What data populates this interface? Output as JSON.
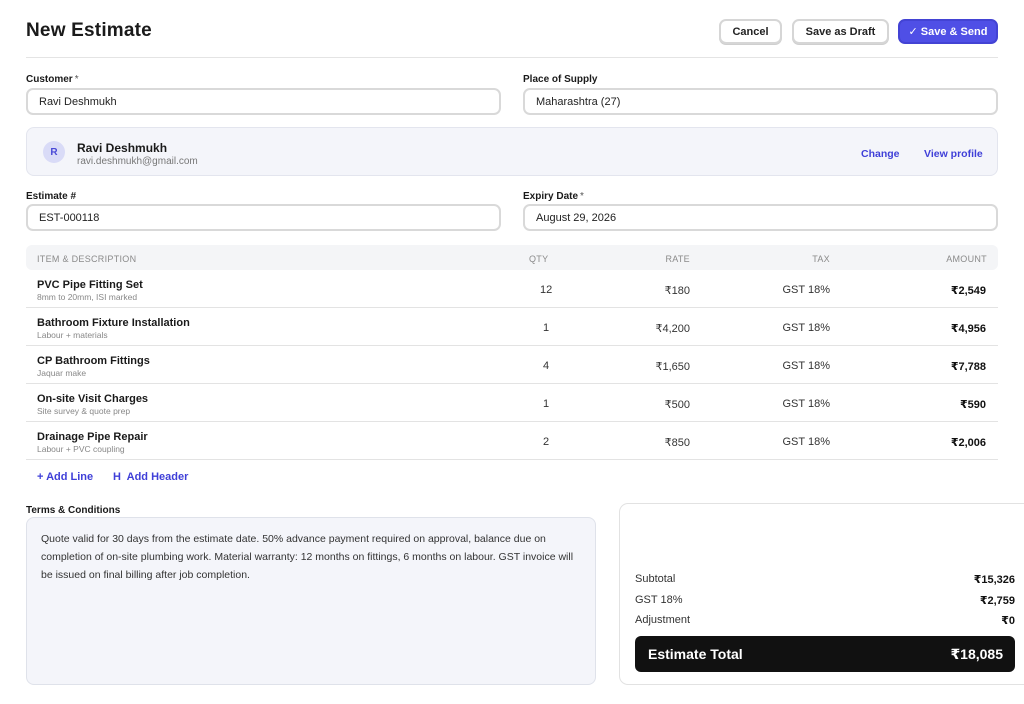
{
  "page": {
    "title": "New Estimate"
  },
  "actions": {
    "cancel": "Cancel",
    "save_draft": "Save as Draft",
    "save_send": "✓ Save & Send"
  },
  "form": {
    "customer_label": "Customer",
    "customer_value": "Ravi Deshmukh",
    "supply_label": "Place of Supply",
    "supply_value": "Maharashtra (27)",
    "estimate_label": "Estimate #",
    "estimate_value": "EST-000118",
    "expiry_label": "Expiry Date",
    "expiry_value": "August 29, 2026",
    "required_mark": "*"
  },
  "customer_card": {
    "initial": "R",
    "name": "Ravi Deshmukh",
    "email": "ravi.deshmukh@gmail.com",
    "change": "Change",
    "view_profile": "View profile"
  },
  "table": {
    "headers": {
      "item": "ITEM & DESCRIPTION",
      "qty": "QTY",
      "rate": "RATE",
      "tax": "TAX",
      "amount": "AMOUNT"
    },
    "rows": [
      {
        "name": "PVC Pipe Fitting Set",
        "desc": "8mm to 20mm, ISI marked",
        "qty": "12",
        "rate": "₹180",
        "tax": "GST 18%",
        "amount": "₹2,549"
      },
      {
        "name": "Bathroom Fixture Installation",
        "desc": "Labour + materials",
        "qty": "1",
        "rate": "₹4,200",
        "tax": "GST 18%",
        "amount": "₹4,956"
      },
      {
        "name": "CP Bathroom Fittings",
        "desc": "Jaquar make",
        "qty": "4",
        "rate": "₹1,650",
        "tax": "GST 18%",
        "amount": "₹7,788"
      },
      {
        "name": "On-site Visit Charges",
        "desc": "Site survey & quote prep",
        "qty": "1",
        "rate": "₹500",
        "tax": "GST 18%",
        "amount": "₹590"
      },
      {
        "name": "Drainage Pipe Repair",
        "desc": "Labour + PVC coupling",
        "qty": "2",
        "rate": "₹850",
        "tax": "GST 18%",
        "amount": "₹2,006"
      }
    ],
    "add_line": "+ Add Line",
    "add_header": "H  Add Header"
  },
  "terms": {
    "label": "Terms & Conditions",
    "text": "Quote valid for 30 days from the estimate date. 50% advance payment required on approval, balance due on completion of on-site plumbing work. Material warranty: 12 months on fittings, 6 months on labour. GST invoice will be issued on final billing after job completion."
  },
  "summary": {
    "subtotal_label": "Subtotal",
    "subtotal": "₹15,326",
    "gst_label": "GST 18%",
    "gst": "₹2,759",
    "adjustment_label": "Adjustment",
    "adjustment": "₹0",
    "total_label": "Estimate Total",
    "total": "₹18,085"
  },
  "colors": {
    "accent": "#4f4fe6",
    "link": "#3f3fd8",
    "total_bg": "#111111"
  }
}
